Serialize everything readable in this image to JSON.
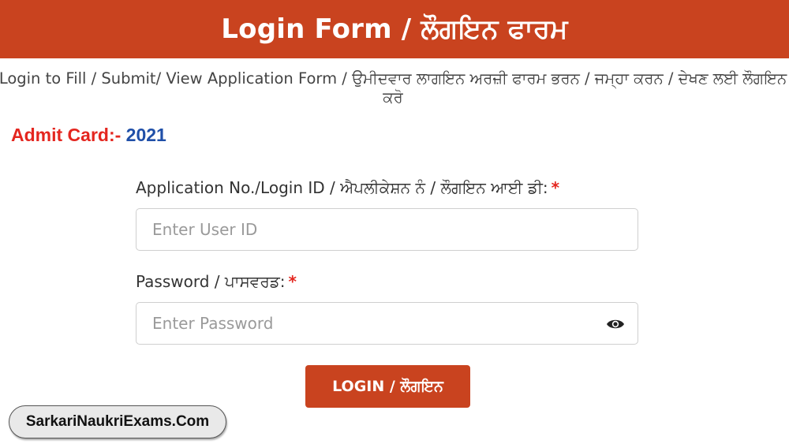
{
  "header": {
    "title": "Login Form / ਲੌਗਇਨ ਫਾਰਮ"
  },
  "subtitle": "Login to Fill / Submit/ View Application Form / ਉਮੀਦਵਾਰ ਲਾਗਇਨ ਅਰਜ਼ੀ ਫਾਰਮ ਭਰਨ / ਜਮ੍ਹਾ ਕਰਨ / ਦੇਖਣ ਲਈ ਲੌਗਇਨ ਕਰੋ",
  "admit_card": {
    "label": "Admit Card:-",
    "year": "2021"
  },
  "form": {
    "user_id": {
      "label": "Application No./Login ID / ਐਪਲੀਕੇਸ਼ਨ ਨੰ / ਲੌਗਇਨ ਆਈ ਡੀ:",
      "required_mark": "*",
      "placeholder": "Enter User ID",
      "value": ""
    },
    "password": {
      "label": "Password / ਪਾਸਵਰਡ:",
      "required_mark": "*",
      "placeholder": "Enter Password",
      "value": "",
      "toggle_icon": "eye-icon"
    },
    "login_button": "LOGIN / ਲੌਗਇਨ"
  },
  "watermark": "SarkariNaukriExams.Com",
  "colors": {
    "primary": "#c9431f",
    "required": "#e4261f",
    "year": "#1f4fa8"
  }
}
